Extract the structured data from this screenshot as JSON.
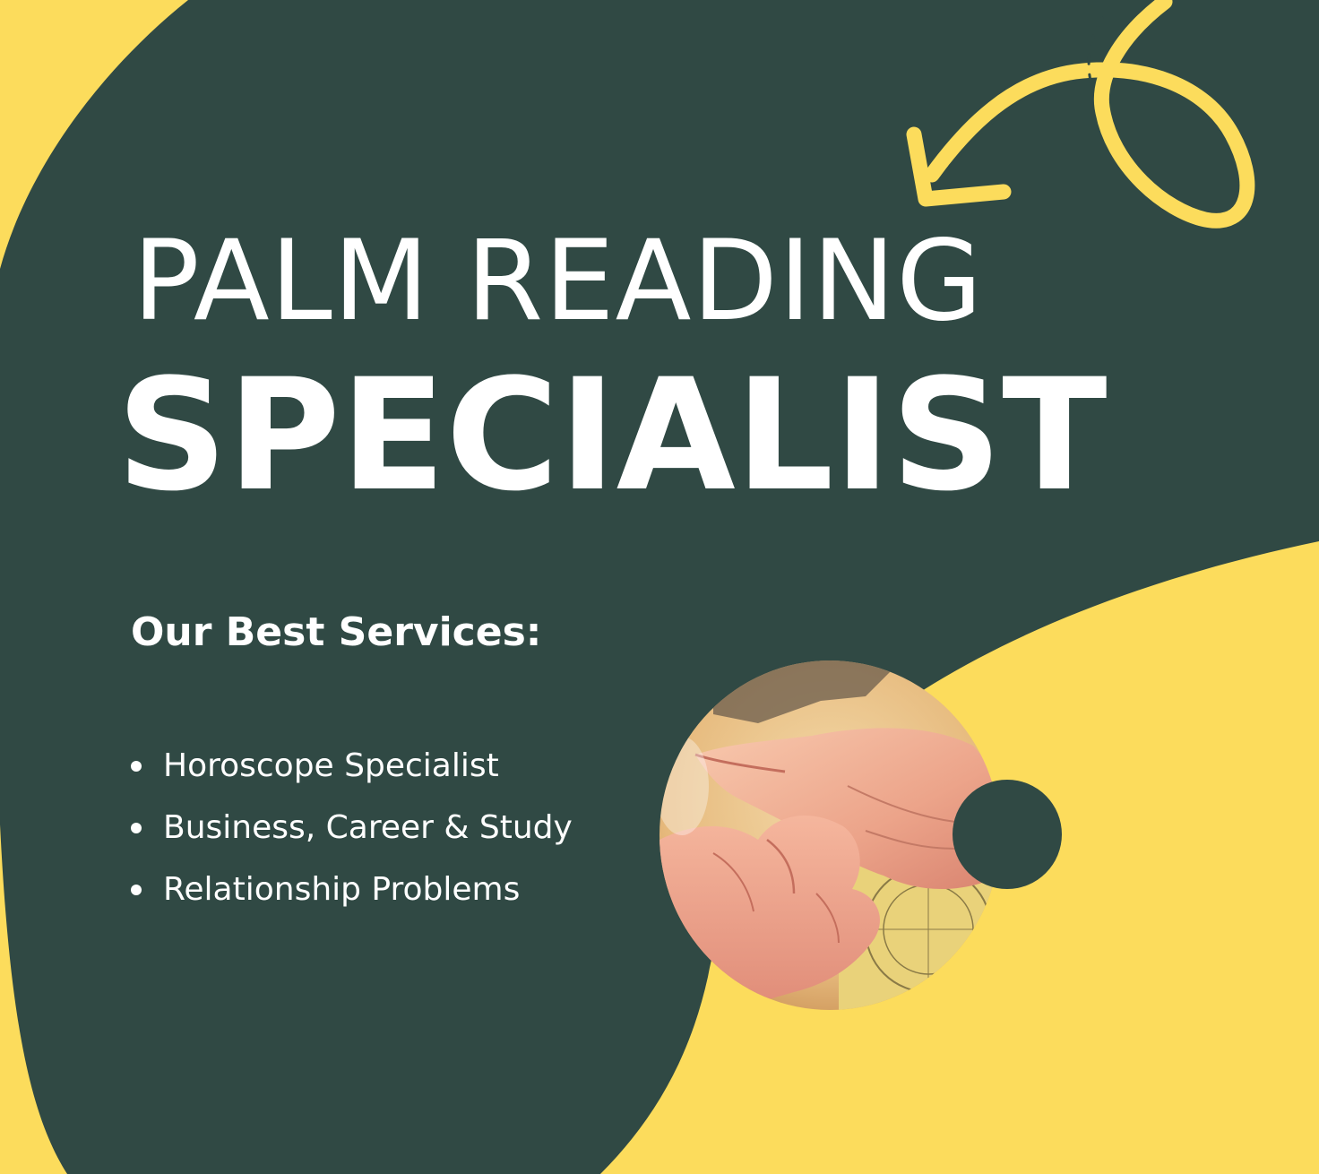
{
  "flyer": {
    "title_line1": "PALM READING",
    "title_line2": "SPECIALIST",
    "services_heading": "Our Best Services:",
    "services": [
      "Horoscope Specialist",
      "Business,  Career & Study",
      "Relationship Problems"
    ]
  },
  "colors": {
    "background_green": "#304944",
    "accent_yellow": "#fcdc5c",
    "text": "#ffffff"
  },
  "images": {
    "palm_photo": "hands-palm-reading-photo",
    "arrow": "curly-arrow-icon"
  }
}
